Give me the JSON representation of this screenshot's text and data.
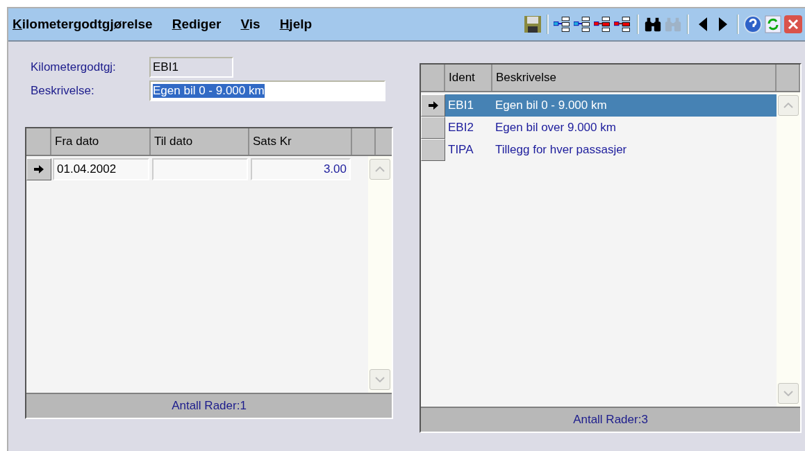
{
  "menu": [
    {
      "label": "Kilometergodtgjørelse"
    },
    {
      "label": "Rediger"
    },
    {
      "label": "Vis"
    },
    {
      "label": "Hjelp"
    }
  ],
  "toolbar": [
    {
      "kind": "save",
      "disabled": false
    },
    {
      "kind": "sep"
    },
    {
      "kind": "insert",
      "disabled": false
    },
    {
      "kind": "append",
      "disabled": false
    },
    {
      "kind": "delete",
      "disabled": false
    },
    {
      "kind": "remove",
      "disabled": false
    },
    {
      "kind": "sep"
    },
    {
      "kind": "find",
      "disabled": false
    },
    {
      "kind": "findnext",
      "disabled": true
    },
    {
      "kind": "sep"
    },
    {
      "kind": "prev",
      "disabled": false
    },
    {
      "kind": "next",
      "disabled": false
    },
    {
      "kind": "sep"
    },
    {
      "kind": "help",
      "disabled": false
    },
    {
      "kind": "refresh",
      "disabled": false
    },
    {
      "kind": "close",
      "disabled": false
    }
  ],
  "form": [
    {
      "label": "Kilometergodtgj:",
      "value": "EBI1",
      "readonly": true,
      "text_selected": false
    },
    {
      "label": "Beskrivelse:",
      "value": "Egen bil 0 - 9.000 km",
      "readonly": false,
      "text_selected": true
    }
  ],
  "periods_table": {
    "editable": true,
    "columns": [
      {
        "label": "Fra dato",
        "kind": "text"
      },
      {
        "label": "Til dato",
        "kind": "text"
      },
      {
        "label": "Sats Kr",
        "kind": "number"
      }
    ],
    "rows": [
      {
        "current": true,
        "selected": false,
        "cells": [
          "01.04.2002",
          "",
          "3.00"
        ]
      }
    ],
    "footer": "Antall Rader:1"
  },
  "list_table": {
    "editable": false,
    "columns": [
      {
        "label": "Ident",
        "kind": "text"
      },
      {
        "label": "Beskrivelse",
        "kind": "text"
      }
    ],
    "rows": [
      {
        "current": true,
        "selected": true,
        "cells": [
          "EBI1",
          "Egen bil 0 - 9.000 km"
        ]
      },
      {
        "current": false,
        "selected": false,
        "cells": [
          "EBI2",
          "Egen bil over 9.000 km"
        ]
      },
      {
        "current": false,
        "selected": false,
        "cells": [
          "TIPA",
          "Tillegg for hver passasjer"
        ]
      }
    ],
    "footer": "Antall Rader:3"
  }
}
